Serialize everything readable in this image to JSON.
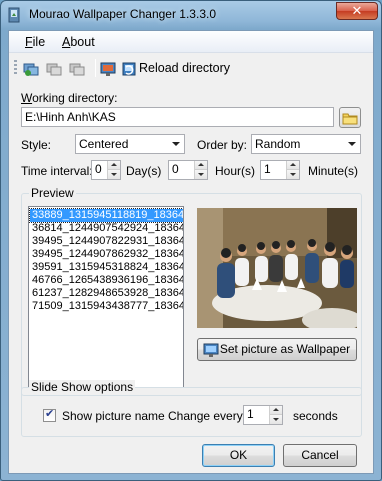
{
  "window": {
    "title": "Mourao Wallpaper Changer 1.3.3.0",
    "close_glyph": "✕"
  },
  "menu": {
    "file": {
      "accel": "F",
      "rest": "ile"
    },
    "about": {
      "accel": "A",
      "rest": "bout"
    }
  },
  "toolbar": {
    "reload_label": "Reload directory"
  },
  "working_dir": {
    "label_accel": "W",
    "label_rest": "orking directory:",
    "value": "E:\\Hinh Anh\\KAS"
  },
  "style": {
    "label": "Style:",
    "value": "Centered"
  },
  "order": {
    "label": "Order by:",
    "value": "Random"
  },
  "interval": {
    "label": "Time interval:",
    "days": "0",
    "days_label": "Day(s)",
    "hours": "0",
    "hours_label": "Hour(s)",
    "minutes": "1",
    "minutes_label": "Minute(s)"
  },
  "preview": {
    "title": "Preview",
    "files": [
      "33889_1315945118819_18364",
      "36814_1244907542924_18364",
      "39495_1244907822931_18364",
      "39495_1244907862932_18364",
      "39591_1315945318824_18364",
      "46766_1265438936196_18364",
      "61237_1282948653928_18364",
      "71509_1315943438777_18364"
    ],
    "selected_index": 0,
    "set_button": "Set picture as Wallpaper"
  },
  "slideshow": {
    "title": "Slide Show options",
    "show_name_label": "Show picture name",
    "show_name_checked": true,
    "change_every_label": "Change every",
    "change_every_value": "1",
    "seconds_label": "seconds"
  },
  "buttons": {
    "ok": "OK",
    "cancel": "Cancel"
  },
  "colors": {
    "selection": "#3399ff",
    "title_gradient_top": "#a9cbe6",
    "close_button": "#c53c22"
  }
}
